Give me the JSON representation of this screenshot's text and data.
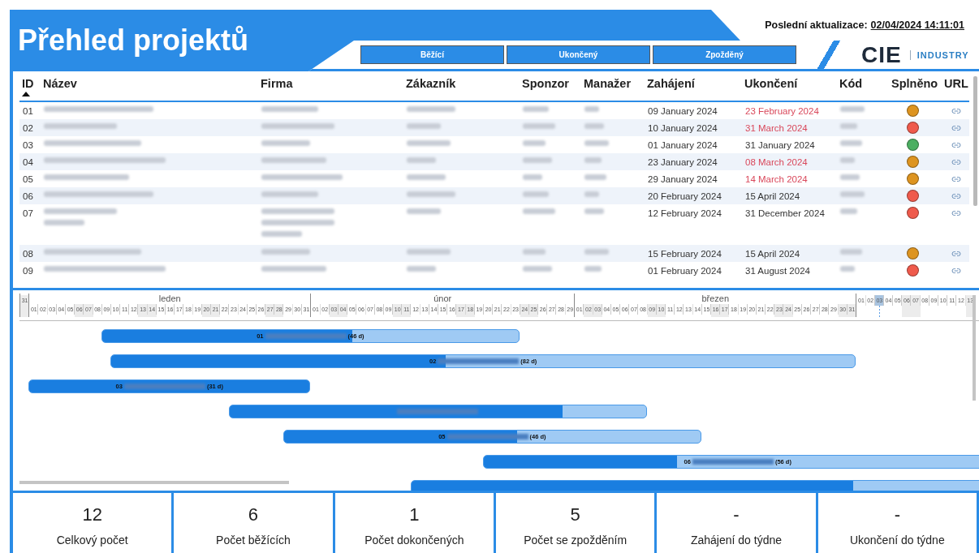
{
  "header": {
    "title": "Přehled projektů",
    "last_update_label": "Poslední aktualizace:",
    "last_update_value": "02/04/2024 14:11:01",
    "filters": [
      {
        "label": "Běžící"
      },
      {
        "label": "Ukončený"
      },
      {
        "label": "Zpožděný"
      }
    ],
    "logo": {
      "mark": "CIE",
      "text": "INDUSTRY"
    }
  },
  "table": {
    "columns": [
      {
        "label": "ID",
        "kind": "id",
        "sorted": true
      },
      {
        "label": "Název",
        "kind": "redacted",
        "sorted": false
      },
      {
        "label": "Firma",
        "kind": "redacted",
        "sorted": false
      },
      {
        "label": "Zákazník",
        "kind": "redacted",
        "sorted": false
      },
      {
        "label": "Sponzor",
        "kind": "redacted",
        "sorted": false
      },
      {
        "label": "Manažer",
        "kind": "redacted",
        "sorted": false
      },
      {
        "label": "Zahájení",
        "kind": "start",
        "sorted": false
      },
      {
        "label": "Ukončení",
        "kind": "end",
        "sorted": false
      },
      {
        "label": "Kód",
        "kind": "redacted",
        "sorted": false
      },
      {
        "label": "Splněno",
        "kind": "status",
        "sorted": false
      },
      {
        "label": "URL",
        "kind": "link",
        "sorted": false
      }
    ],
    "rows": [
      {
        "id": "01",
        "start": "09 January 2024",
        "end": "23 February 2024",
        "overdue": true,
        "color": "#dd9420",
        "wrapped": false
      },
      {
        "id": "02",
        "start": "10 January 2024",
        "end": "31 March 2024",
        "overdue": true,
        "color": "#ef5a4c",
        "wrapped": false
      },
      {
        "id": "03",
        "start": "01 January 2024",
        "end": "31 January 2024",
        "overdue": false,
        "color": "#4caf62",
        "wrapped": false
      },
      {
        "id": "04",
        "start": "23 January 2024",
        "end": "08 March 2024",
        "overdue": true,
        "color": "#dd9420",
        "wrapped": false
      },
      {
        "id": "05",
        "start": "29 January 2024",
        "end": "14 March 2024",
        "overdue": true,
        "color": "#dd9420",
        "wrapped": false
      },
      {
        "id": "06",
        "start": "20 February 2024",
        "end": "15 April 2024",
        "overdue": false,
        "color": "#ef5a4c",
        "wrapped": false
      },
      {
        "id": "07",
        "start": "12 February 2024",
        "end": "31 December 2024",
        "overdue": false,
        "color": "#ef5a4c",
        "wrapped": true
      },
      {
        "id": "08",
        "start": "15 February 2024",
        "end": "15 April 2024",
        "overdue": false,
        "color": "#dd9420",
        "wrapped": false
      },
      {
        "id": "09",
        "start": "01 February 2024",
        "end": "31 August 2024",
        "overdue": false,
        "color": "#ef5a4c",
        "wrapped": false
      }
    ]
  },
  "gantt": {
    "months": [
      {
        "days": [
          {
            "day": "31",
            "kind": "day",
            "color": "#ececec"
          }
        ]
      },
      {
        "label": "leden",
        "days": [
          {
            "day": "01",
            "kind": "day",
            "color": "#ffffff"
          },
          {
            "day": "02",
            "kind": "day",
            "color": "#ffffff"
          },
          {
            "day": "03",
            "kind": "day",
            "color": "#ffffff"
          },
          {
            "day": "04",
            "kind": "day",
            "color": "#ffffff"
          },
          {
            "day": "05",
            "kind": "day",
            "color": "#ffffff"
          },
          {
            "day": "06",
            "kind": "day",
            "color": "#ececec"
          },
          {
            "day": "07",
            "kind": "day",
            "color": "#ececec"
          },
          {
            "day": "08",
            "kind": "day",
            "color": "#ffffff"
          },
          {
            "day": "09",
            "kind": "day",
            "color": "#ffffff"
          },
          {
            "day": "10",
            "kind": "day",
            "color": "#ffffff"
          },
          {
            "day": "11",
            "kind": "day",
            "color": "#ffffff"
          },
          {
            "day": "12",
            "kind": "day",
            "color": "#ffffff"
          },
          {
            "day": "13",
            "kind": "day",
            "color": "#ececec"
          },
          {
            "day": "14",
            "kind": "day",
            "color": "#ececec"
          },
          {
            "day": "15",
            "kind": "day",
            "color": "#ffffff"
          },
          {
            "day": "16",
            "kind": "day",
            "color": "#ffffff"
          },
          {
            "day": "17",
            "kind": "day",
            "color": "#ffffff"
          },
          {
            "day": "18",
            "kind": "day",
            "color": "#ffffff"
          },
          {
            "day": "19",
            "kind": "day",
            "color": "#ffffff"
          },
          {
            "day": "20",
            "kind": "day",
            "color": "#ececec"
          },
          {
            "day": "21",
            "kind": "day",
            "color": "#ececec"
          },
          {
            "day": "22",
            "kind": "day",
            "color": "#ffffff"
          },
          {
            "day": "23",
            "kind": "day",
            "color": "#ffffff"
          },
          {
            "day": "24",
            "kind": "day",
            "color": "#ffffff"
          },
          {
            "day": "25",
            "kind": "day",
            "color": "#ffffff"
          },
          {
            "day": "26",
            "kind": "day",
            "color": "#ffffff"
          },
          {
            "day": "27",
            "kind": "day",
            "color": "#ececec"
          },
          {
            "day": "28",
            "kind": "day",
            "color": "#ececec"
          },
          {
            "day": "29",
            "kind": "day",
            "color": "#ffffff"
          },
          {
            "day": "30",
            "kind": "day",
            "color": "#ffffff"
          },
          {
            "day": "31",
            "kind": "day",
            "color": "#ffffff"
          }
        ]
      },
      {
        "label": "únor",
        "days": [
          {
            "day": "01",
            "kind": "day",
            "color": "#ffffff"
          },
          {
            "day": "02",
            "kind": "day",
            "color": "#ffffff"
          },
          {
            "day": "03",
            "kind": "day",
            "color": "#ececec"
          },
          {
            "day": "04",
            "kind": "day",
            "color": "#ececec"
          },
          {
            "day": "05",
            "kind": "day",
            "color": "#ffffff"
          },
          {
            "day": "06",
            "kind": "day",
            "color": "#ffffff"
          },
          {
            "day": "07",
            "kind": "day",
            "color": "#ffffff"
          },
          {
            "day": "08",
            "kind": "day",
            "color": "#ffffff"
          },
          {
            "day": "09",
            "kind": "day",
            "color": "#ffffff"
          },
          {
            "day": "10",
            "kind": "day",
            "color": "#ececec"
          },
          {
            "day": "11",
            "kind": "day",
            "color": "#ececec"
          },
          {
            "day": "12",
            "kind": "day",
            "color": "#ffffff"
          },
          {
            "day": "13",
            "kind": "day",
            "color": "#ffffff"
          },
          {
            "day": "14",
            "kind": "day",
            "color": "#ffffff"
          },
          {
            "day": "15",
            "kind": "day",
            "color": "#ffffff"
          },
          {
            "day": "16",
            "kind": "day",
            "color": "#ffffff"
          },
          {
            "day": "17",
            "kind": "day",
            "color": "#ececec"
          },
          {
            "day": "18",
            "kind": "day",
            "color": "#ececec"
          },
          {
            "day": "19",
            "kind": "day",
            "color": "#ffffff"
          },
          {
            "day": "20",
            "kind": "day",
            "color": "#ffffff"
          },
          {
            "day": "21",
            "kind": "day",
            "color": "#ffffff"
          },
          {
            "day": "22",
            "kind": "day",
            "color": "#ffffff"
          },
          {
            "day": "23",
            "kind": "day",
            "color": "#ffffff"
          },
          {
            "day": "24",
            "kind": "day",
            "color": "#ececec"
          },
          {
            "day": "25",
            "kind": "day",
            "color": "#ececec"
          },
          {
            "day": "26",
            "kind": "day",
            "color": "#ffffff"
          },
          {
            "day": "27",
            "kind": "day",
            "color": "#ffffff"
          },
          {
            "day": "28",
            "kind": "day",
            "color": "#ffffff"
          },
          {
            "day": "29",
            "kind": "day",
            "color": "#ffffff"
          }
        ]
      },
      {
        "label": "březen",
        "days": [
          {
            "day": "01",
            "kind": "day",
            "color": "#ffffff"
          },
          {
            "day": "02",
            "kind": "day",
            "color": "#ececec"
          },
          {
            "day": "03",
            "kind": "day",
            "color": "#ececec"
          },
          {
            "day": "04",
            "kind": "day",
            "color": "#ffffff"
          },
          {
            "day": "05",
            "kind": "day",
            "color": "#ffffff"
          },
          {
            "day": "06",
            "kind": "day",
            "color": "#ffffff"
          },
          {
            "day": "07",
            "kind": "day",
            "color": "#ffffff"
          },
          {
            "day": "08",
            "kind": "day",
            "color": "#ffffff"
          },
          {
            "day": "09",
            "kind": "day",
            "color": "#ececec"
          },
          {
            "day": "10",
            "kind": "day",
            "color": "#ececec"
          },
          {
            "day": "11",
            "kind": "day",
            "color": "#ffffff"
          },
          {
            "day": "12",
            "kind": "day",
            "color": "#ffffff"
          },
          {
            "day": "13",
            "kind": "day",
            "color": "#ffffff"
          },
          {
            "day": "14",
            "kind": "day",
            "color": "#ffffff"
          },
          {
            "day": "15",
            "kind": "day",
            "color": "#ffffff"
          },
          {
            "day": "16",
            "kind": "day",
            "color": "#ececec"
          },
          {
            "day": "17",
            "kind": "day",
            "color": "#ececec"
          },
          {
            "day": "18",
            "kind": "day",
            "color": "#ffffff"
          },
          {
            "day": "19",
            "kind": "day",
            "color": "#ffffff"
          },
          {
            "day": "20",
            "kind": "day",
            "color": "#ffffff"
          },
          {
            "day": "21",
            "kind": "day",
            "color": "#ffffff"
          },
          {
            "day": "22",
            "kind": "day",
            "color": "#ffffff"
          },
          {
            "day": "23",
            "kind": "day",
            "color": "#ececec"
          },
          {
            "day": "24",
            "kind": "day",
            "color": "#ececec"
          },
          {
            "day": "25",
            "kind": "day",
            "color": "#ffffff"
          },
          {
            "day": "26",
            "kind": "day",
            "color": "#ffffff"
          },
          {
            "day": "27",
            "kind": "day",
            "color": "#ffffff"
          },
          {
            "day": "28",
            "kind": "day",
            "color": "#ffffff"
          },
          {
            "day": "29",
            "kind": "day",
            "color": "#ffffff"
          },
          {
            "day": "30",
            "kind": "day",
            "color": "#ececec"
          },
          {
            "day": "31",
            "kind": "day",
            "color": "#ececec"
          }
        ]
      },
      {
        "days": [
          {
            "day": "01",
            "kind": "day",
            "color": "#ffffff"
          },
          {
            "day": "02",
            "kind": "day",
            "color": "#ffffff"
          },
          {
            "day": "03",
            "kind": "today",
            "color": "#ffffff"
          },
          {
            "day": "04",
            "kind": "day",
            "color": "#ffffff"
          },
          {
            "day": "05",
            "kind": "day",
            "color": "#ffffff"
          },
          {
            "day": "06",
            "kind": "day",
            "color": "#ececec"
          },
          {
            "day": "07",
            "kind": "day",
            "color": "#ececec"
          },
          {
            "day": "08",
            "kind": "day",
            "color": "#ffffff"
          },
          {
            "day": "09",
            "kind": "day",
            "color": "#ffffff"
          },
          {
            "day": "10",
            "kind": "day",
            "color": "#ffffff"
          },
          {
            "day": "11",
            "kind": "day",
            "color": "#ffffff"
          },
          {
            "day": "12",
            "kind": "day",
            "color": "#ffffff"
          },
          {
            "day": "13",
            "kind": "day",
            "color": "#ececec"
          }
        ]
      }
    ],
    "bars": [
      {
        "kind": "labelled",
        "id": "01",
        "duration": "(46 d)",
        "level": 0.6
      },
      {
        "kind": "labelled",
        "id": "02",
        "duration": "(82 d)",
        "level": 0.45
      },
      {
        "kind": "labelled",
        "id": "03",
        "duration": "(31 d)",
        "level": 1
      },
      {
        "kind": "labelled",
        "level": 0.8
      },
      {
        "kind": "labelled",
        "id": "05",
        "duration": "(46 d)",
        "level": 0.56
      },
      {
        "kind": "labelled",
        "id": "06",
        "duration": "(56 d)",
        "level": 0.38
      },
      {
        "kind": "plain",
        "level": 0.15
      }
    ]
  },
  "summary": [
    {
      "value": "12",
      "label": "Celkový počet"
    },
    {
      "value": "6",
      "label": "Počet běžících"
    },
    {
      "value": "1",
      "label": "Počet dokončených"
    },
    {
      "value": "5",
      "label": "Počet se zpožděním"
    },
    {
      "value": "-",
      "label": "Zahájení do týdne"
    },
    {
      "value": "-",
      "label": "Ukončení do týdne"
    }
  ]
}
